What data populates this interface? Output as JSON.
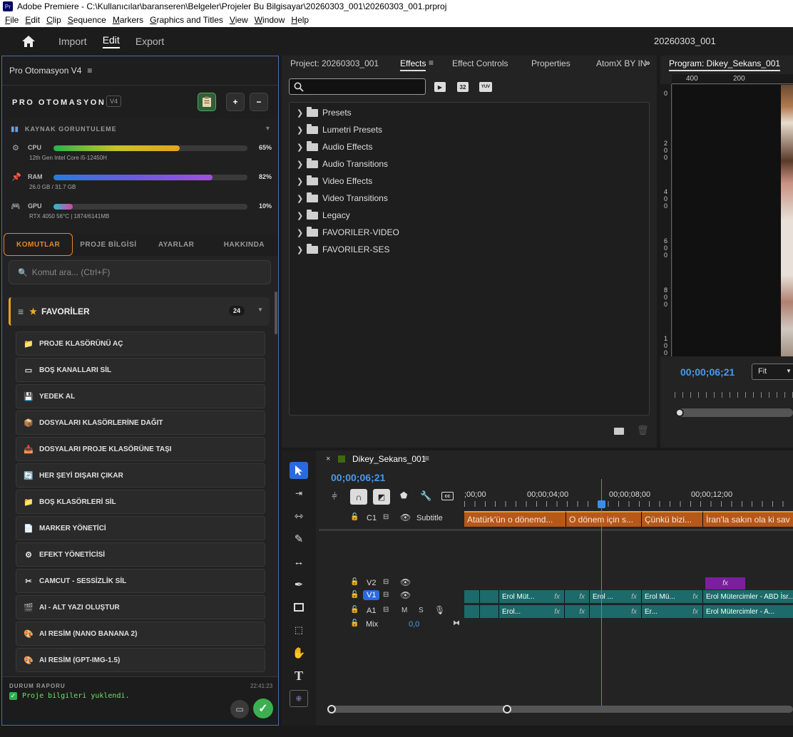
{
  "app": {
    "title": "Adobe Premiere - C:\\Kullanıcılar\\baranseren\\Belgeler\\Projeler Bu Bilgisayar\\20260303_001\\20260303_001.prproj",
    "icon": "Pr"
  },
  "menu": [
    "File",
    "Edit",
    "Clip",
    "Sequence",
    "Markers",
    "Graphics and Titles",
    "View",
    "Window",
    "Help"
  ],
  "workspace": {
    "tabs": [
      "Import",
      "Edit",
      "Export"
    ],
    "active": "Edit",
    "project_name": "20260303_001"
  },
  "left_panel": {
    "header": "Pro Otomasyon V4",
    "brand": "PRO OTOMASYON",
    "version": "V4",
    "resources_title": "KAYNAK GORUNTULEME",
    "cpu": {
      "label": "CPU",
      "percent": 65,
      "percent_text": "65%",
      "detail": "12th Gen Intel Core i5-12450H"
    },
    "ram": {
      "label": "RAM",
      "percent": 82,
      "percent_text": "82%",
      "detail": "26.0 GB / 31.7 GB"
    },
    "gpu": {
      "label": "GPU",
      "percent": 10,
      "percent_text": "10%",
      "detail": "RTX 4050 56°C | 1874/6141MB"
    },
    "tabs": [
      "KOMUTLAR",
      "PROJE BİLGİSİ",
      "AYARLAR",
      "HAKKINDA"
    ],
    "active_tab": "KOMUTLAR",
    "search_placeholder": "Komut ara... (Ctrl+F)",
    "favorites": {
      "label": "FAVORİLER",
      "count": "24"
    },
    "commands": [
      {
        "icon": "folder-icon",
        "label": "PROJE KLASÖRÜNÜ AÇ"
      },
      {
        "icon": "tray-icon",
        "label": "BOŞ KANALLARI SİL"
      },
      {
        "icon": "floppy-icon",
        "label": "YEDEK AL"
      },
      {
        "icon": "box-icon",
        "label": "DOSYALARI KLASÖRLERİNE DAĞIT"
      },
      {
        "icon": "inbox-icon",
        "label": "DOSYALARI PROJE KLASÖRÜNE TAŞI"
      },
      {
        "icon": "refresh-icon",
        "label": "HER ŞEYİ DIŞARI ÇIKAR"
      },
      {
        "icon": "folder-icon",
        "label": "BOŞ KLASÖRLERİ SİL"
      },
      {
        "icon": "document-icon",
        "label": "MARKER YÖNETİCİ"
      },
      {
        "icon": "gear-icon",
        "label": "EFEKT YÖNETİCİSİ"
      },
      {
        "icon": "scissors-icon",
        "label": "CAMCUT - SESSİZLİK SİL"
      },
      {
        "icon": "clapper-icon",
        "label": "AI - ALT YAZI OLUŞTUR"
      },
      {
        "icon": "palette-icon",
        "label": "AI RESİM (NANO BANANA 2)"
      },
      {
        "icon": "palette-icon",
        "label": "AI RESİM (GPT-IMG-1.5)"
      }
    ],
    "status": {
      "title": "DURUM RAPORU",
      "time": "22:41:23",
      "message": "Proje bilgileri yuklendi."
    }
  },
  "project_panel": {
    "tabs": [
      "Project: 20260303_001",
      "Effects",
      "Effect Controls",
      "Properties",
      "AtomX BY IN"
    ],
    "active_tab": "Effects",
    "toolbar_badges": [
      "32",
      "YUV"
    ],
    "folders": [
      "Presets",
      "Lumetri Presets",
      "Audio Effects",
      "Audio Transitions",
      "Video Effects",
      "Video Transitions",
      "Legacy",
      "FAVORILER-VIDEO",
      "FAVORILER-SES"
    ]
  },
  "program_monitor": {
    "title": "Program: Dikey_Sekans_001",
    "ruler_top": [
      "400",
      "200"
    ],
    "ruler_left": [
      "0",
      "200",
      "400",
      "600",
      "800",
      "100"
    ],
    "timecode": "00;00;06;21",
    "fit": "Fit"
  },
  "timeline": {
    "sequence": "Dikey_Sekans_001",
    "timecode": "00;00;06;21",
    "ruler": [
      ";00;00",
      "00;00;04;00",
      "00;00;08;00",
      "00;00;12;00"
    ],
    "tracks": {
      "subtitle": {
        "label": "C1",
        "name": "Subtitle"
      },
      "v2": "V2",
      "v1": "V1",
      "a1": "A1",
      "mix": {
        "label": "Mix",
        "value": "0,0"
      }
    },
    "subtitle_clips": [
      "Atatürk'ün o dönemd...",
      "O dönem için s...",
      "Çünkü bizi...",
      "İran'la sakın ola ki sav"
    ],
    "v1_clips": [
      "Erol Müt...",
      "Erol ...",
      "Erol Mü...",
      "Erol Mütercimler - ABD İsr..."
    ],
    "a1_clips": [
      "Erol...",
      "Er...",
      "Erol Mütercimler - A..."
    ],
    "fx": "fx",
    "colors": {
      "subtitle": "#b5581a",
      "video": "#1c6a6a",
      "v2": "#7a1fa0",
      "playhead": "#3a8eea"
    }
  }
}
